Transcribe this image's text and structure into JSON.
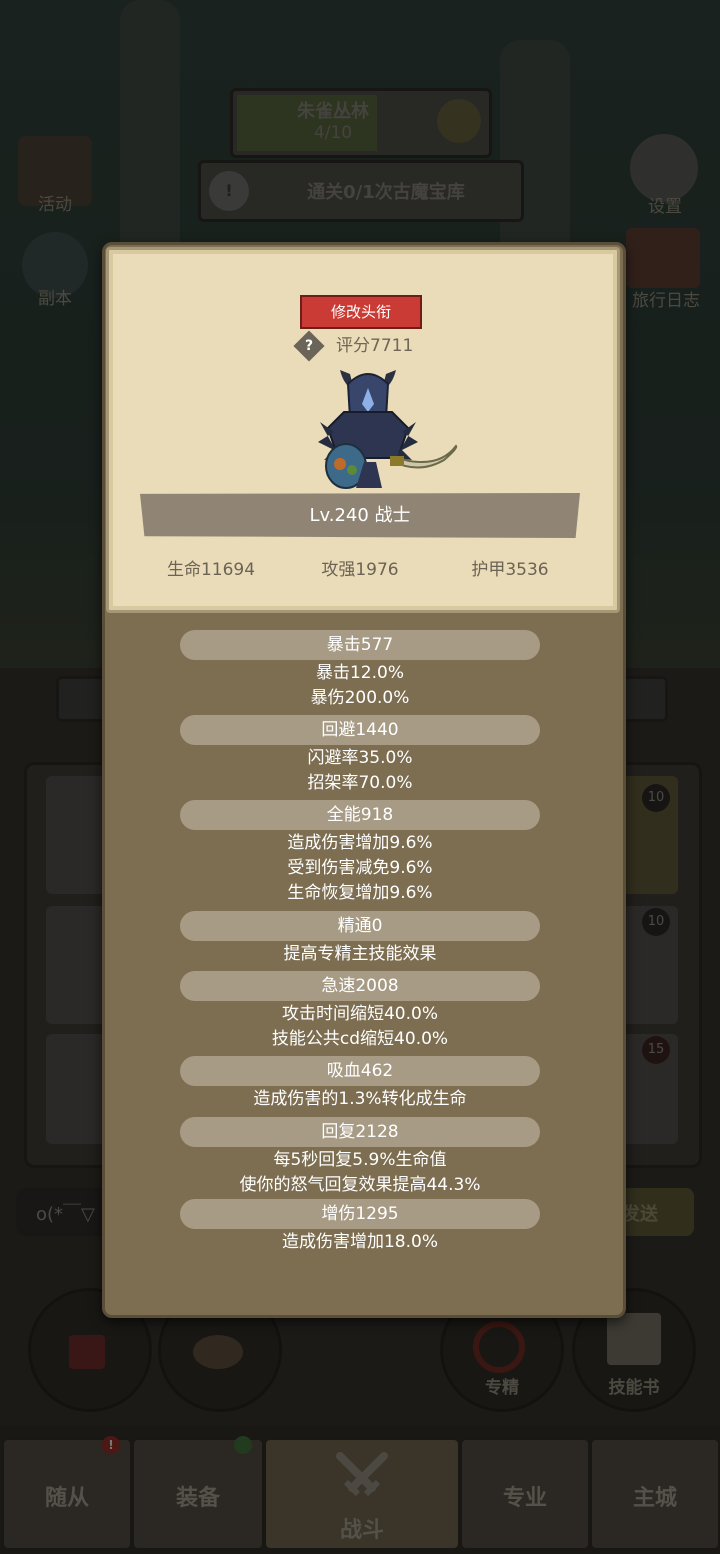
{
  "background": {
    "stage_name": "朱雀丛林",
    "stage_progress": "4/10",
    "quest": "通关0/1次古魔宝库",
    "left_buttons": [
      "活动",
      "副本"
    ],
    "right_buttons": [
      "设置",
      "旅行日志"
    ],
    "chat_placeholder": "o(*￣▽",
    "send_label": "发送",
    "badge_numbers": [
      "10",
      "10",
      "15"
    ],
    "skill_buttons": [
      "专精",
      "技能书"
    ]
  },
  "bottom_tabs": [
    "随从",
    "装备",
    "战斗",
    "专业",
    "主城"
  ],
  "panel": {
    "change_title_button": "修改头衔",
    "help_icon": "?",
    "score": "评分7711",
    "level_class": "Lv.240 战士",
    "base_stats": [
      "生命11694",
      "攻强1976",
      "护甲3536"
    ],
    "stat_groups": [
      {
        "head": "暴击577",
        "lines": [
          "暴击12.0%",
          "暴伤200.0%"
        ]
      },
      {
        "head": "回避1440",
        "lines": [
          "闪避率35.0%",
          "招架率70.0%"
        ]
      },
      {
        "head": "全能918",
        "lines": [
          "造成伤害增加9.6%",
          "受到伤害减免9.6%",
          "生命恢复增加9.6%"
        ]
      },
      {
        "head": "精通0",
        "lines": [
          "提高专精主技能效果"
        ]
      },
      {
        "head": "急速2008",
        "lines": [
          "攻击时间缩短40.0%",
          "技能公共cd缩短40.0%"
        ]
      },
      {
        "head": "吸血462",
        "lines": [
          "造成伤害的1.3%转化成生命"
        ]
      },
      {
        "head": "回复2128",
        "lines": [
          "每5秒回复5.9%生命值",
          "使你的怒气回复效果提高44.3%"
        ]
      },
      {
        "head": "增伤1295",
        "lines": [
          "造成伤害增加18.0%"
        ]
      }
    ]
  },
  "colors": {
    "title_button": "#c93b34",
    "panel": "#7d6e52",
    "card": "#eadcb8"
  }
}
